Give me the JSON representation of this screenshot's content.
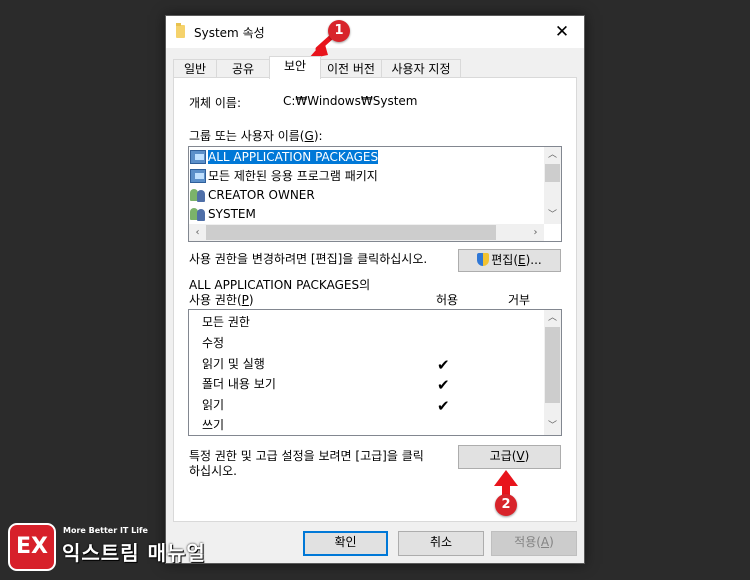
{
  "window": {
    "title": "System 속성",
    "close_label": "✕"
  },
  "tabs": [
    {
      "label": "일반",
      "active": false
    },
    {
      "label": "공유",
      "active": false
    },
    {
      "label": "보안",
      "active": true
    },
    {
      "label": "이전 버전",
      "active": false
    },
    {
      "label": "사용자 지정",
      "active": false
    }
  ],
  "security": {
    "object_name_label": "개체 이름:",
    "object_name_value": "C:₩Windows₩System",
    "groups_label": "그룹 또는 사용자 이름(",
    "groups_accel": "G",
    "groups_label_end": "):",
    "groups": [
      {
        "name": "ALL APPLICATION PACKAGES",
        "icon": "package-icon",
        "selected": true
      },
      {
        "name": "모든 제한된 응용 프로그램 패키지",
        "icon": "package-icon",
        "selected": false
      },
      {
        "name": "CREATOR OWNER",
        "icon": "users-icon",
        "selected": false
      },
      {
        "name": "SYSTEM",
        "icon": "users-icon",
        "selected": false
      }
    ],
    "change_perm_text": "사용 권한을 변경하려면 [편집]을 클릭하십시오.",
    "edit_button": {
      "label": "편집(",
      "accel": "E",
      "label_end": ")..."
    },
    "perm_for_label": "ALL APPLICATION PACKAGES의",
    "perm_label": "사용 권한(",
    "perm_accel": "P",
    "perm_label_end": ")",
    "allow_header": "허용",
    "deny_header": "거부",
    "permissions": [
      {
        "name": "모든 권한",
        "allow": false,
        "deny": false
      },
      {
        "name": "수정",
        "allow": false,
        "deny": false
      },
      {
        "name": "읽기 및 실행",
        "allow": true,
        "deny": false
      },
      {
        "name": "폴더 내용 보기",
        "allow": true,
        "deny": false
      },
      {
        "name": "읽기",
        "allow": true,
        "deny": false
      },
      {
        "name": "쓰기",
        "allow": false,
        "deny": false
      }
    ],
    "check_glyph": "✔",
    "advanced_text_line1": "특정 권한 및 고급 설정을 보려면 [고급]을 클릭",
    "advanced_text_line2": "하십시오.",
    "advanced_button": {
      "label": "고급(",
      "accel": "V",
      "label_end": ")"
    }
  },
  "footer": {
    "ok_label": "확인",
    "cancel_label": "취소",
    "apply_label": "적용(",
    "apply_accel": "A",
    "apply_label_end": ")"
  },
  "annotations": {
    "step1": "1",
    "step2": "2",
    "color": "#d8242b"
  },
  "watermark": {
    "mark": "EX",
    "tagline": "More Better IT Life",
    "name": "익스트림 매뉴얼"
  },
  "colors": {
    "selection": "#0078d7",
    "default_button_border": "#0078d7"
  }
}
